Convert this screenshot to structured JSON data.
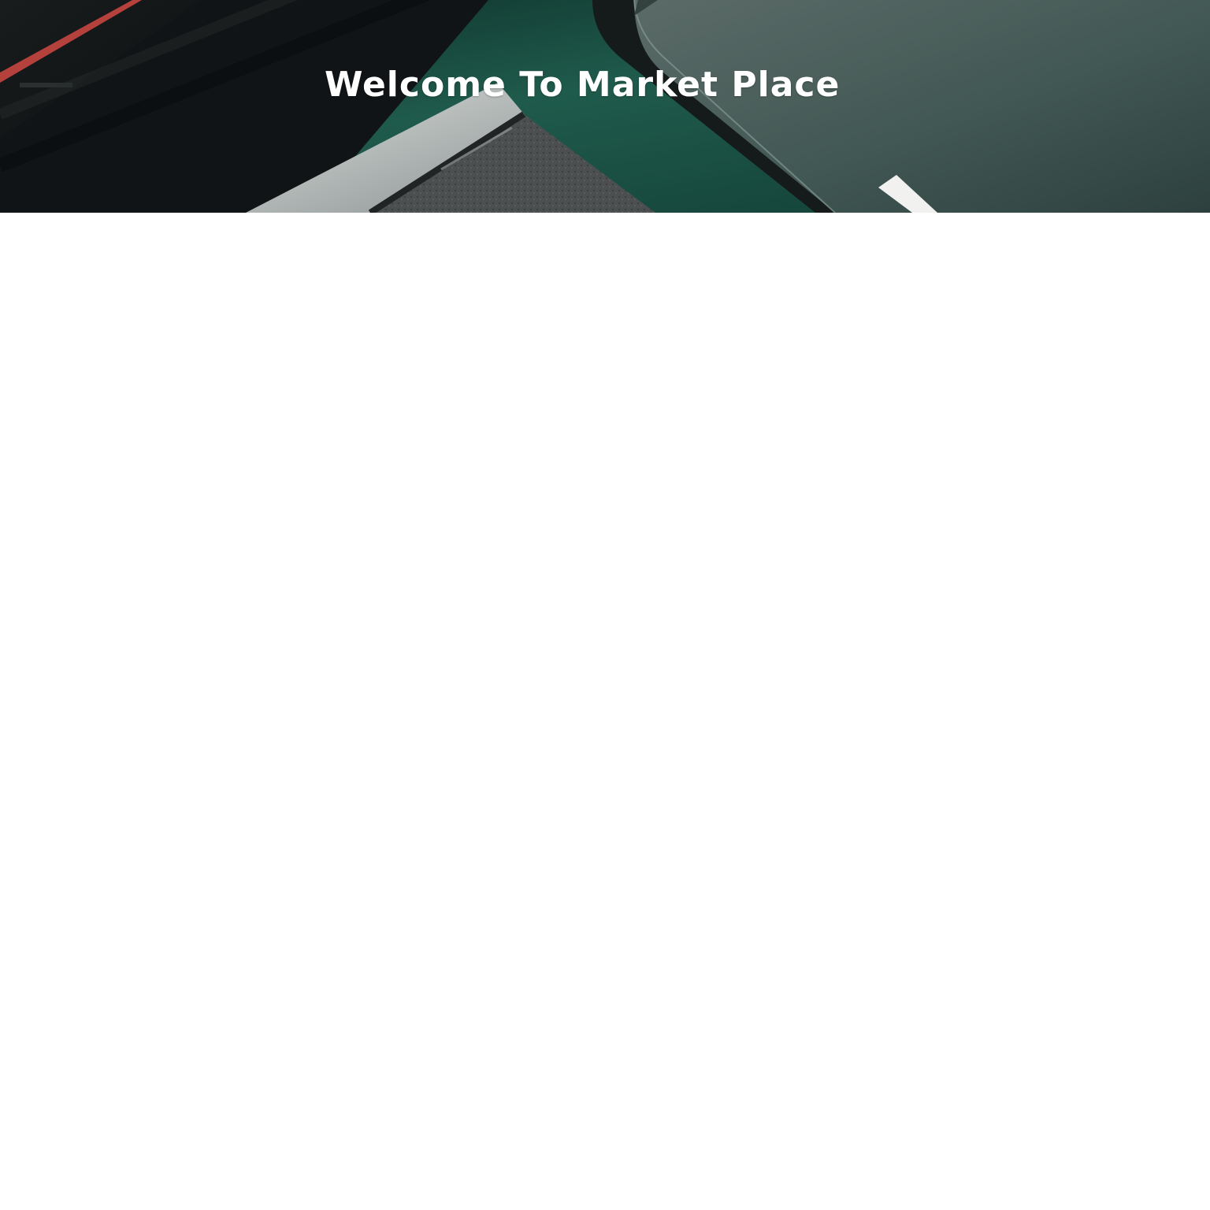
{
  "hero": {
    "title": "Welcome To Market Place",
    "background_image": "dark-green-devices-photo",
    "colors": {
      "surface_green": "#1f5a4b",
      "panel_dark": "#111819",
      "panel_gray": "#4f6460",
      "accent_red": "#c5463f",
      "title_text": "#ffffff"
    }
  },
  "page": {
    "background": "#ffffff"
  }
}
